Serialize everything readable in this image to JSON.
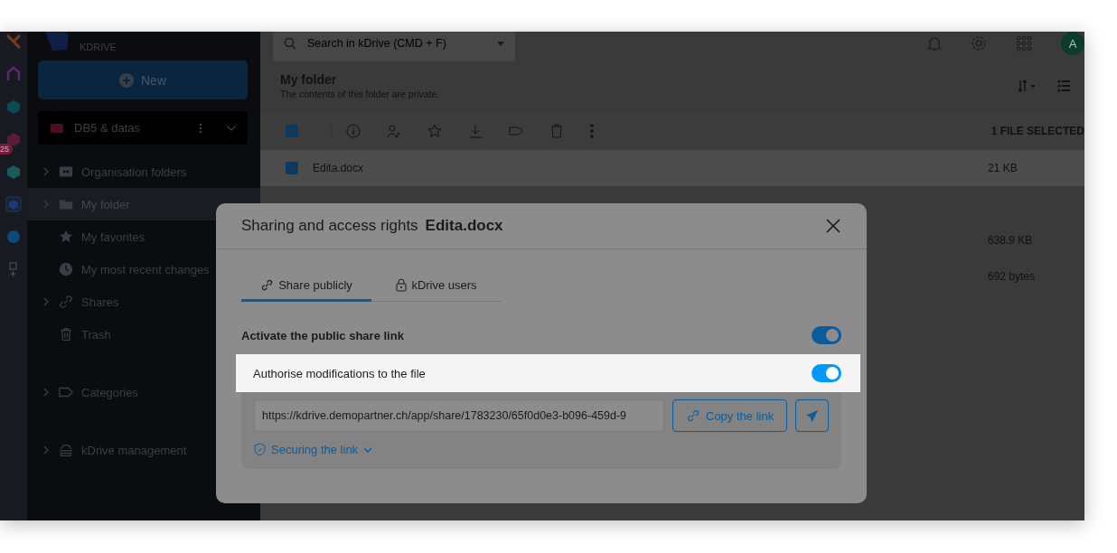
{
  "rail": {
    "badge": "25"
  },
  "sidebar": {
    "product": "KDRIVE",
    "new_button": "New",
    "drive": {
      "name": "DB5 & datas"
    },
    "items": [
      {
        "label": "Organisation folders",
        "kind": "org",
        "expandable": true,
        "selected": false
      },
      {
        "label": "My folder",
        "kind": "folder",
        "expandable": true,
        "selected": true
      },
      {
        "label": "My favorites",
        "kind": "star",
        "expandable": false,
        "selected": false
      },
      {
        "label": "My most recent changes",
        "kind": "clock",
        "expandable": false,
        "selected": false
      },
      {
        "label": "Shares",
        "kind": "link",
        "expandable": true,
        "selected": false
      },
      {
        "label": "Trash",
        "kind": "trash",
        "expandable": false,
        "selected": false
      },
      {
        "label": "Categories",
        "kind": "tag",
        "expandable": true,
        "selected": false
      },
      {
        "label": "kDrive management",
        "kind": "manage",
        "expandable": true,
        "selected": false
      }
    ]
  },
  "search": {
    "placeholder": "Search in kDrive (CMD + F)"
  },
  "avatar": "A",
  "header": {
    "title": "My folder",
    "subtitle": "The contents of this folder are private."
  },
  "toolbar": {
    "select_all_partial": true,
    "selection_count": "1 FILE SELECTED"
  },
  "files": [
    {
      "name": "Edita.docx",
      "size": "21 KB",
      "selected": true
    },
    {
      "selected": false
    },
    {
      "size": "638.9 KB",
      "selected": false
    },
    {
      "size": "692 bytes",
      "selected": false
    }
  ],
  "dialog": {
    "title": "Sharing and access rights",
    "file": "Edita.docx",
    "tabs": [
      {
        "label": "Share publicly",
        "kind": "link",
        "selected": true
      },
      {
        "label": "kDrive users",
        "kind": "lock",
        "selected": false
      }
    ],
    "settings": [
      {
        "label": "Activate the public share link",
        "on": true,
        "highlighted": false
      },
      {
        "label": "Authorise modifications to the file",
        "on": true,
        "highlighted": true
      }
    ],
    "link": {
      "value": "https://kdrive.demopartner.ch/app/share/1783230/65f0d0e3-b096-459d-9"
    },
    "copy_button": "Copy the link",
    "securing": "Securing the link"
  }
}
